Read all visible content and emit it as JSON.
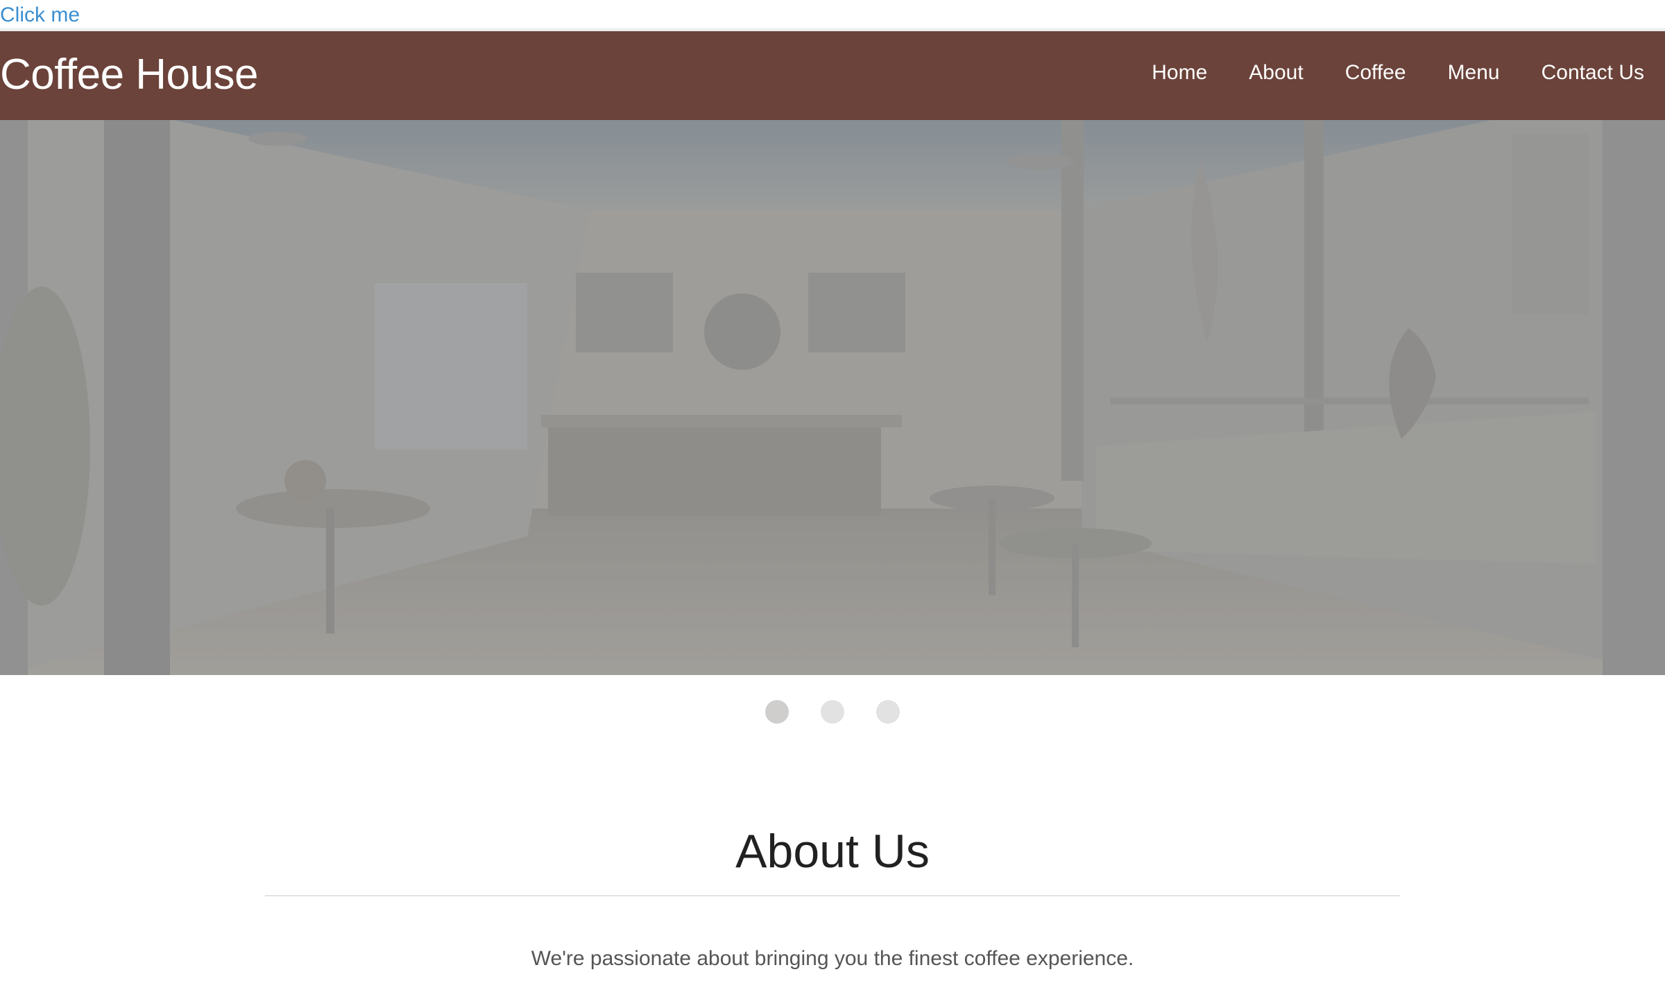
{
  "skip_link": {
    "label": "Click me"
  },
  "navbar": {
    "brand": "Coffee House",
    "links": [
      {
        "label": "Home"
      },
      {
        "label": "About"
      },
      {
        "label": "Coffee"
      },
      {
        "label": "Menu"
      },
      {
        "label": "Contact Us"
      }
    ]
  },
  "carousel": {
    "slide_count": 3,
    "active_index": 0
  },
  "about": {
    "title": "About Us",
    "text": "We're passionate about bringing you the finest coffee experience."
  },
  "colors": {
    "navbar_bg": "#6b433a",
    "link_blue": "#3a8ed0",
    "dot_active": "#d0cdcd",
    "dot_inactive": "#e2e2e2"
  }
}
